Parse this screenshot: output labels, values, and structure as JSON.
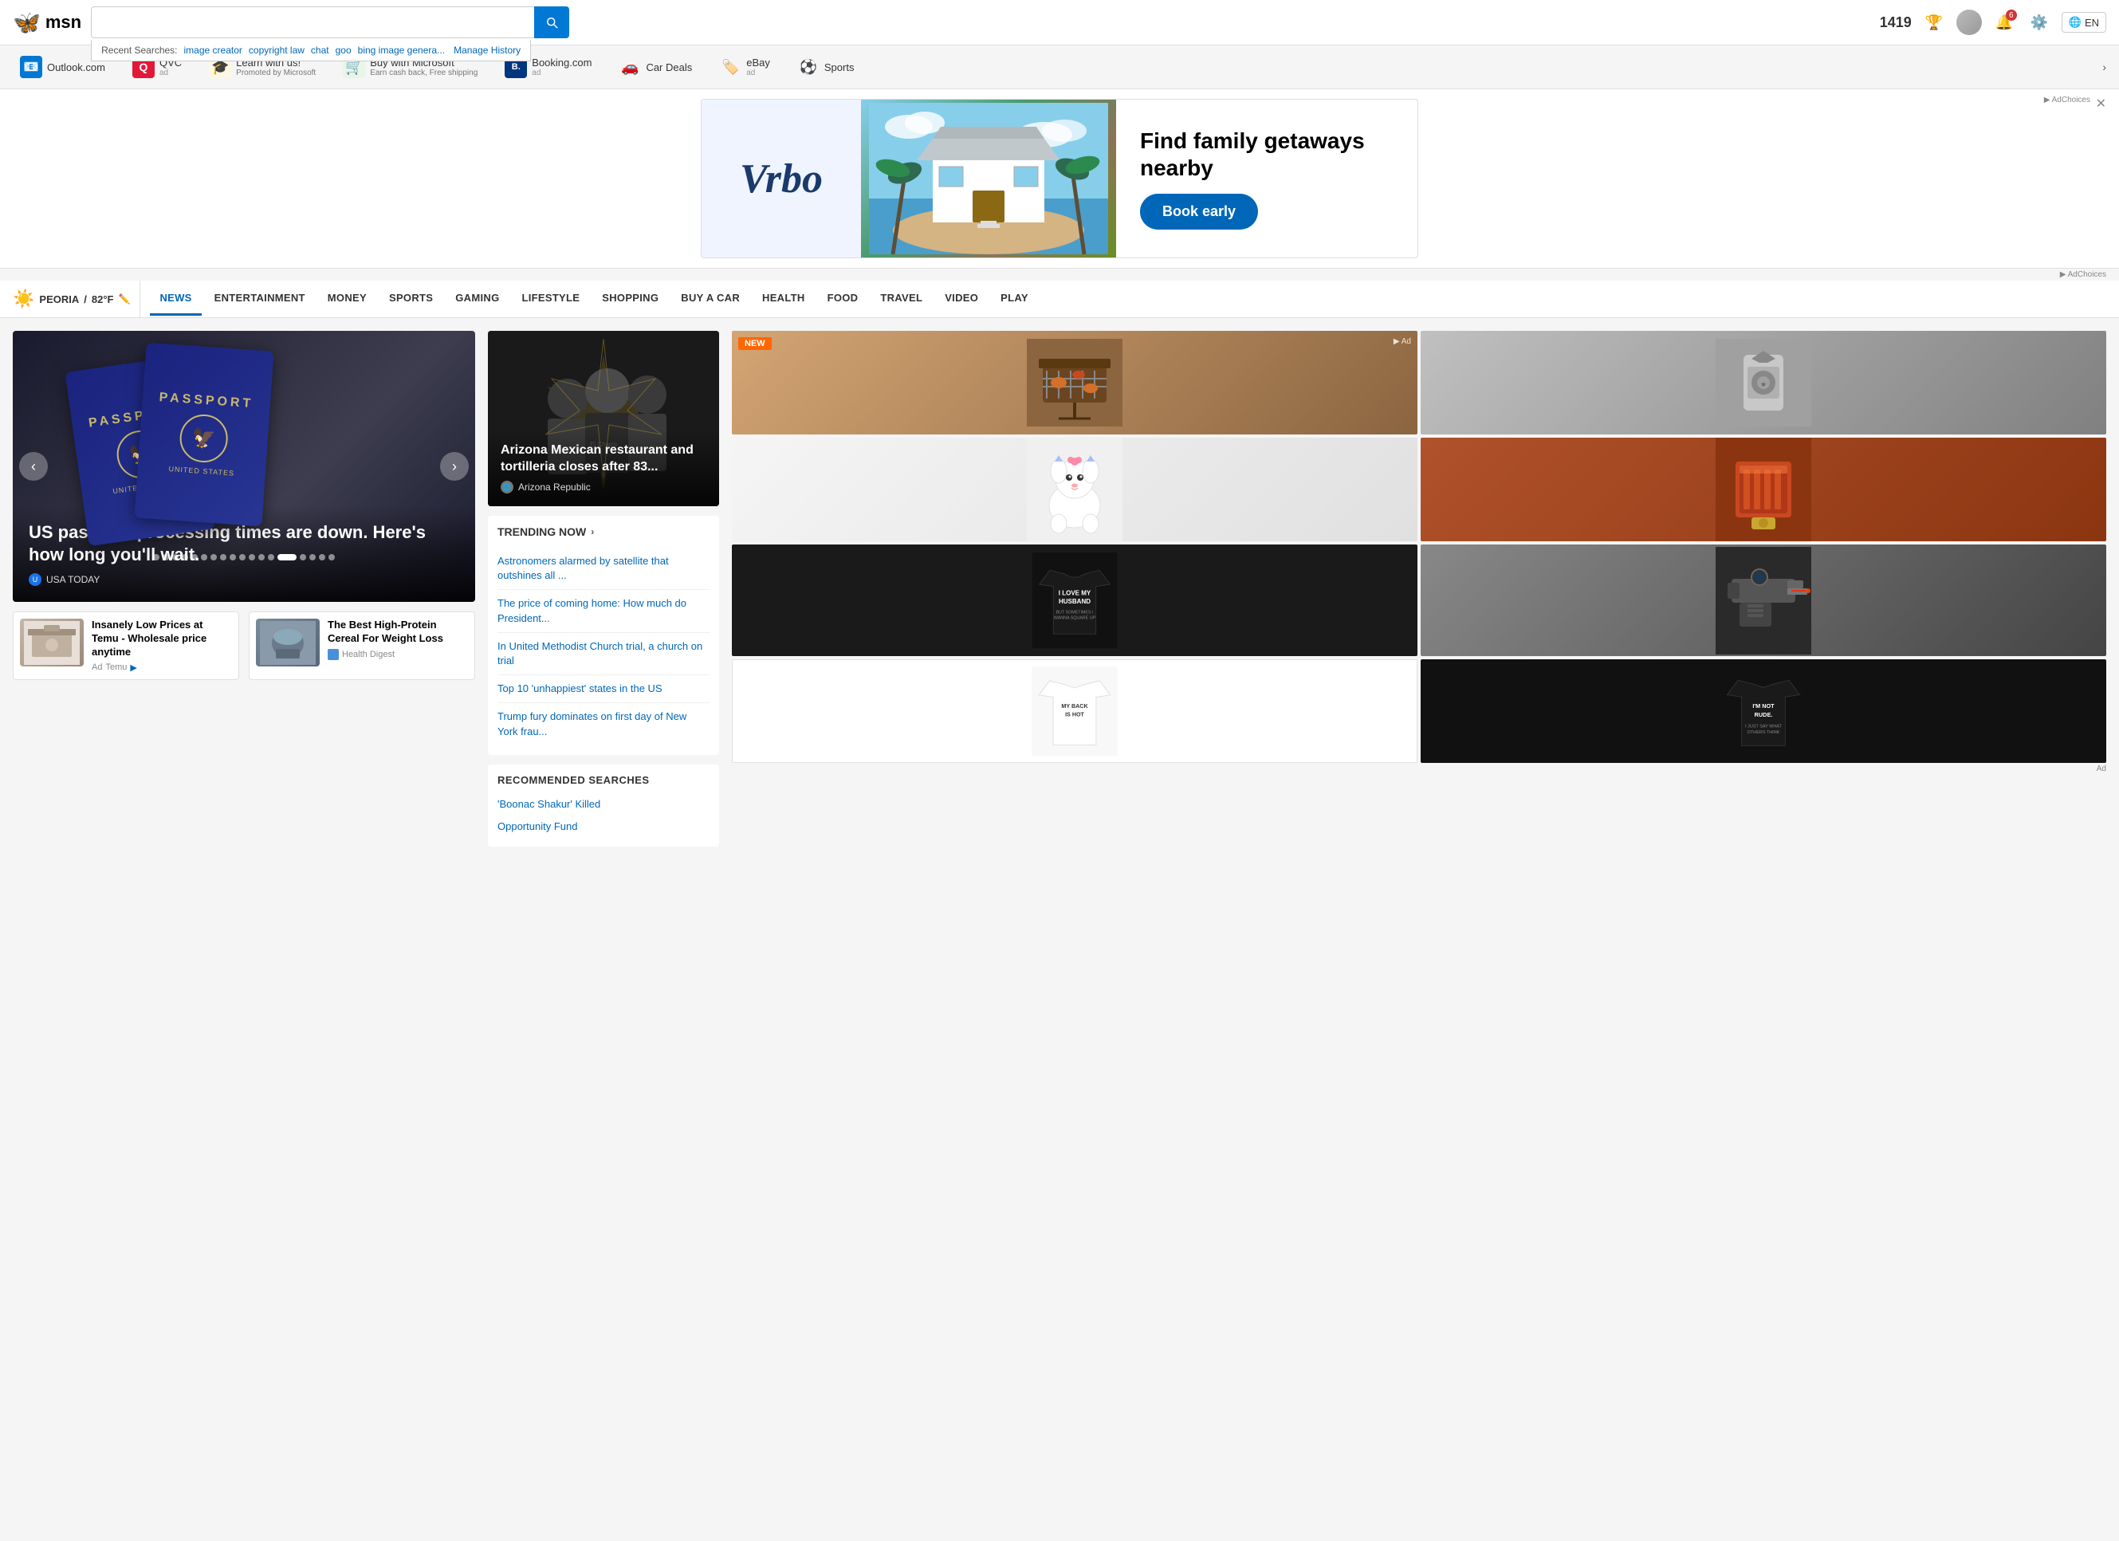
{
  "header": {
    "logo_text": "msn",
    "logo_icon": "🦋",
    "search_placeholder": "",
    "search_value": "",
    "recent_searches_label": "Recent Searches:",
    "recent_searches": [
      "image creator",
      "copyright law",
      "chat",
      "goo",
      "bing image genera..."
    ],
    "manage_history": "Manage History",
    "score": "1419",
    "lang": "EN",
    "notification_count": "6"
  },
  "quicklinks": {
    "items": [
      {
        "icon": "📧",
        "label": "Outlook.com",
        "sub": "",
        "ad": false,
        "icon_class": "outlook"
      },
      {
        "icon": "Q",
        "label": "QVC",
        "sub": "ad",
        "ad": true,
        "icon_class": "qvc"
      },
      {
        "icon": "🎓",
        "label": "Learn with us!",
        "sub": "Promoted by Microsoft",
        "ad": false,
        "icon_class": "learn"
      },
      {
        "icon": "🛒",
        "label": "Buy with Microsoft",
        "sub": "Earn cash back, Free shipping",
        "ad": false,
        "icon_class": "microsoft"
      },
      {
        "icon": "B.",
        "label": "Booking.com",
        "sub": "ad",
        "ad": true,
        "icon_class": "booking"
      },
      {
        "icon": "🚗",
        "label": "Car Deals",
        "sub": "",
        "ad": false,
        "icon_class": "cardeals"
      },
      {
        "icon": "🏷️",
        "label": "eBay",
        "sub": "ad",
        "ad": true,
        "icon_class": "ebay"
      },
      {
        "icon": "⚽",
        "label": "Sports",
        "sub": "",
        "ad": false,
        "icon_class": "sports"
      }
    ]
  },
  "ad_banner": {
    "brand": "Vrbo",
    "headline": "Find family getaways nearby",
    "cta": "Book early",
    "ad_label": "Ad"
  },
  "adchoices_bar": {
    "label": "▶ AdChoices"
  },
  "content_nav": {
    "weather_city": "PEORIA",
    "weather_temp": "82°F",
    "items": [
      "NEWS",
      "ENTERTAINMENT",
      "MONEY",
      "SPORTS",
      "GAMING",
      "LIFESTYLE",
      "SHOPPING",
      "BUY A CAR",
      "HEALTH",
      "FOOD",
      "TRAVEL",
      "VIDEO",
      "PLAY"
    ]
  },
  "hero": {
    "title": "US passport processing times are down. Here's how long you'll wait.",
    "source": "USA TODAY",
    "carousel_dots": 18,
    "active_dot": 14
  },
  "small_cards": [
    {
      "title": "Insanely Low Prices at Temu - Wholesale price anytime",
      "ad_label": "Ad",
      "source": "Temu"
    },
    {
      "title": "The Best High-Protein Cereal For Weight Loss",
      "source": "Health Digest"
    }
  ],
  "restaurant_card": {
    "title": "Arizona Mexican restaurant and tortilleria closes after 83...",
    "source": "Arizona Republic"
  },
  "trending": {
    "label": "TRENDING NOW",
    "items": [
      "Astronomers alarmed by satellite that outshines all ...",
      "The price of coming home: How much do President...",
      "In United Methodist Church trial, a church on trial",
      "Top 10 'unhappiest' states in the US",
      "Trump fury dominates on first day of New York frau..."
    ]
  },
  "recommended": {
    "label": "RECOMMENDED SEARCHES",
    "items": [
      "'Boonac Shakur' Killed",
      "Opportunity Fund"
    ]
  },
  "right_ads": {
    "new_badge": "NEW",
    "shirt_text_1": "I LOVE MY HUSBAND",
    "shirt_subtext_1": "BUT SOMETIMES I WANNA SQUARE UP",
    "shirt_text_2": "MY BACK IS HOT",
    "shirt_text_3": "I'M NOT RUDE."
  }
}
